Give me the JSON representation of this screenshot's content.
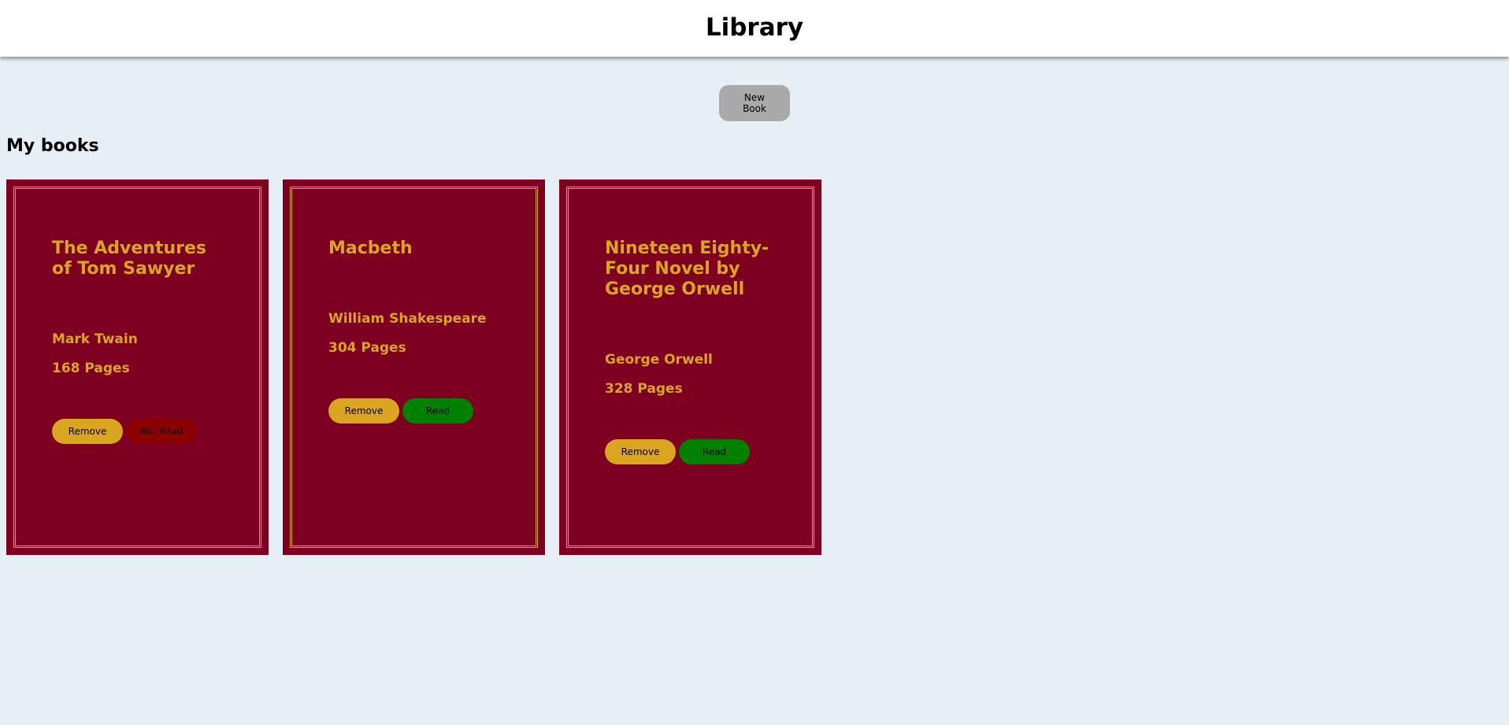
{
  "header": {
    "title": "Library"
  },
  "toolbar": {
    "new_book_label": "New Book"
  },
  "section": {
    "title": "My books"
  },
  "books": [
    {
      "title": "The Adventures of Tom Sawyer",
      "author": "Mark Twain",
      "pages": "168 Pages",
      "remove_label": "Remove",
      "status_label": "Not Read"
    },
    {
      "title": "Macbeth",
      "author": "William Shakespeare",
      "pages": "304 Pages",
      "remove_label": "Remove",
      "status_label": "Read"
    },
    {
      "title": "Nineteen Eighty-Four Novel by George Orwell",
      "author": "George Orwell",
      "pages": "328 Pages",
      "remove_label": "Remove",
      "status_label": "Read"
    }
  ],
  "colors": {
    "page_bg": "#e6eef6",
    "book_bg": "#7d0021",
    "accent_gold": "#daa520",
    "read_green": "#008000",
    "not_read_red": "#8b0000",
    "new_book_gray": "#a9a9a9"
  }
}
